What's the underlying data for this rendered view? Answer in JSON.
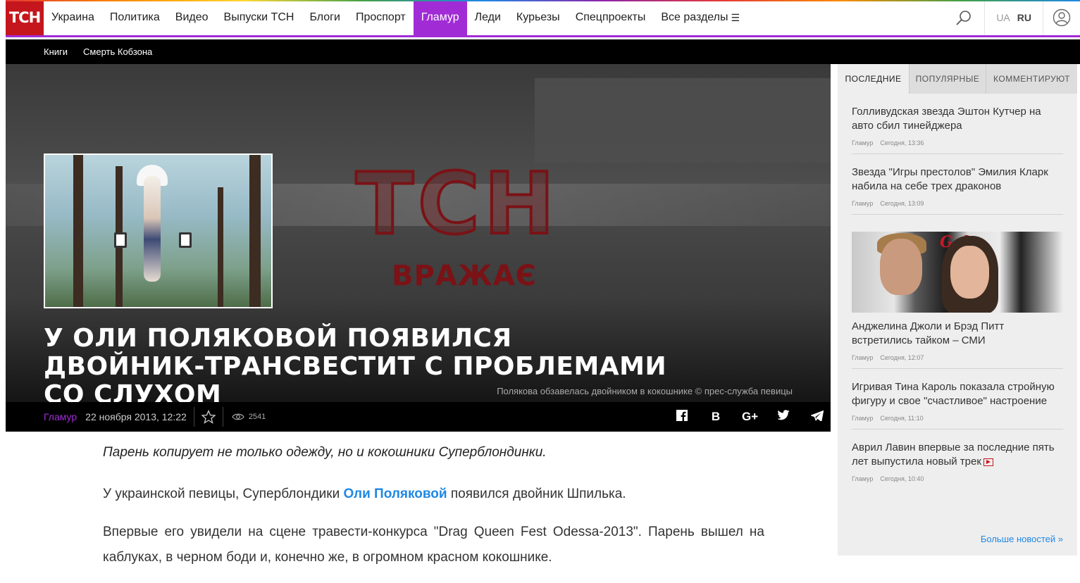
{
  "header": {
    "logo": "ТСН",
    "nav": [
      "Украина",
      "Политика",
      "Видео",
      "Выпуски ТСН",
      "Блоги",
      "Проспорт",
      "Гламур",
      "Леди",
      "Курьезы",
      "Спецпроекты",
      "Все разделы"
    ],
    "active_index": 6,
    "lang_ua": "UA",
    "lang_ru": "RU",
    "accent": "#a12cd6",
    "brand": "#c4161c"
  },
  "subnav": [
    "Книги",
    "Смерть Кобзона"
  ],
  "hero": {
    "watermark": "ТСН",
    "watermark_sub": "ВРАЖАЄ",
    "title": "У Оли Поляковой появился двойник-трансвестит с проблемами со слухом",
    "caption": "Полякова обзавелась двойником в кокошнике © прес-служба певицы"
  },
  "meta": {
    "category": "Гламур",
    "date": "22 ноября 2013, 12:22",
    "views": "2541",
    "social": [
      "facebook-icon",
      "vk-icon",
      "google-plus-icon",
      "twitter-icon",
      "telegram-icon"
    ]
  },
  "article": {
    "lead": "Парень копирует не только одежду, но и кокошники Суперблондинки.",
    "p1_before": "У украинской певицы, Суперблондики ",
    "p1_link": "Оли Поляковой",
    "p1_after": " появился двойник Шпилька.",
    "p2": "Впервые его увидели на сцене травести-конкурса \"Drag Queen Fest Odessa-2013\". Парень вышел на каблуках, в черном боди и, конечно же, в огромном красном кокошнике."
  },
  "sidebar": {
    "tabs": [
      "ПОСЛЕДНИЕ",
      "ПОПУЛЯРНЫЕ",
      "КОММЕНТИРУЮТ"
    ],
    "news": [
      {
        "title": "Голливудская звезда Эштон Кутчер на авто сбил тинейджера",
        "cat": "Гламур",
        "time": "Сегодня, 13:36"
      },
      {
        "title": "Звезда \"Игры престолов\" Эмилия Кларк набила на себе трех драконов",
        "cat": "Гламур",
        "time": "Сегодня, 13:09"
      },
      {
        "title": "Анджелина Джоли и Брэд Питт встретились тайком – СМИ",
        "cat": "Гламур",
        "time": "Сегодня, 12:07"
      },
      {
        "title": "Игривая Тина Кароль показала стройную фигуру и свое \"счастливое\" настроение",
        "cat": "Гламур",
        "time": "Сегодня, 11:10"
      },
      {
        "title": "Аврил Лавин впервые за последние пять лет выпустила новый трек",
        "cat": "Гламур",
        "time": "Сегодня, 10:40"
      }
    ],
    "photo_text": "Gala",
    "more": "Больше новостей »"
  }
}
